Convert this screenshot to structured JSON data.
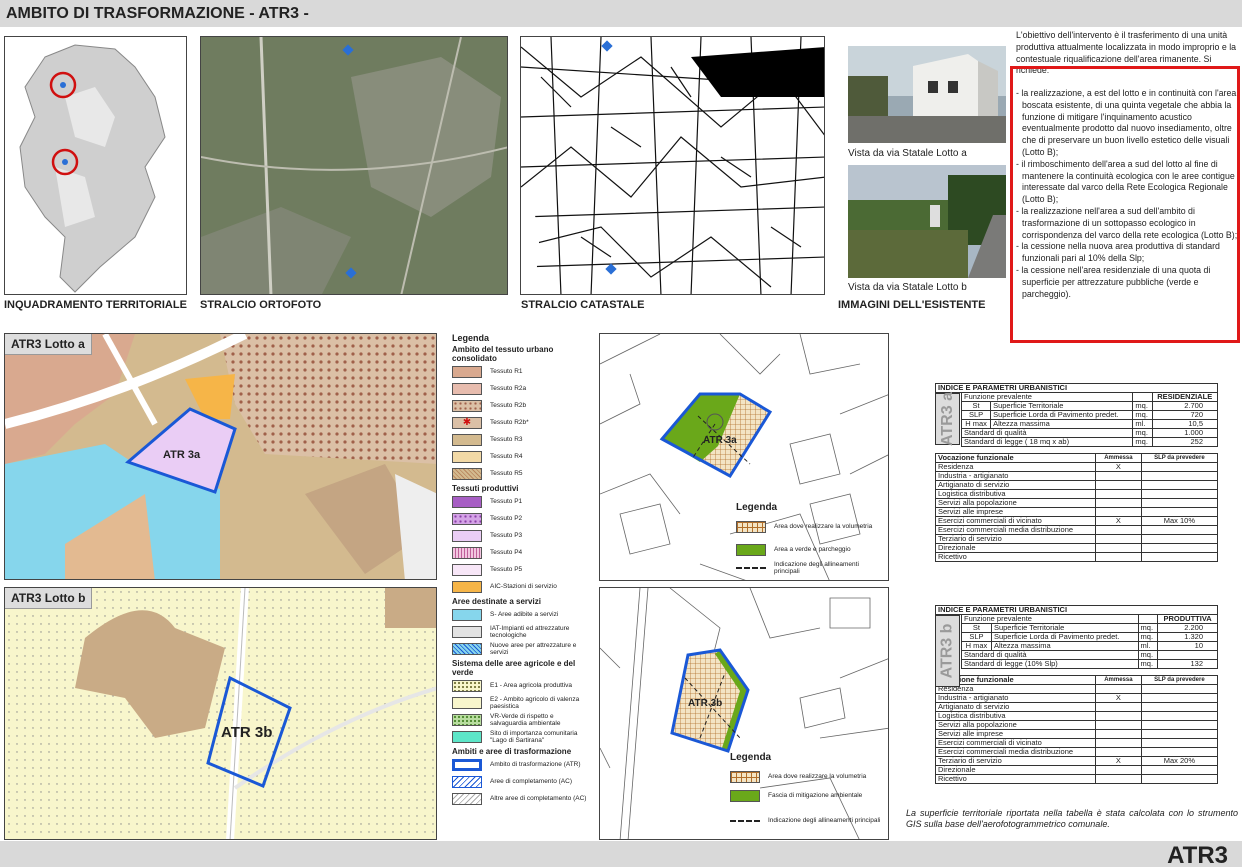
{
  "header": {
    "title": "AMBITO DI TRASFORMAZIONE - ATR3 -"
  },
  "footer": {
    "label": "ATR3"
  },
  "panels": {
    "inquadramento": "INQUADRAMENTO TERRITORIALE",
    "ortofoto": "STRALCIO ORTOFOTO",
    "catastale": "STRALCIO CATASTALE",
    "immagini": "IMMAGINI DELL'ESISTENTE"
  },
  "photos": {
    "a_caption": "Vista da via Statale Lotto a",
    "b_caption": "Vista da via Statale Lotto b"
  },
  "description": {
    "intro": "L'obiettivo dell'intervento è il trasferimento di una unità produttiva attualmente localizzata in modo improprio e la contestuale riqualificazione dell'area rimanente. Si richiede:",
    "items": [
      "- la realizzazione, a est del lotto e in continuità con l'area boscata esistente, di una quinta vegetale che abbia la funzione di mitigare l'inquinamento acustico eventualmente prodotto dal nuovo insediamento, oltre che di preservare un buon livello estetico delle visuali (Lotto B);",
      "- il rimboschimento dell'area a sud del lotto al fine di mantenere la continuità ecologica con le aree contigue interessate dal varco della Rete Ecologica Regionale (Lotto B);",
      "- la realizzazione nell'area a sud dell'ambito di trasformazione di un sottopasso ecologico in corrispondenza del varco della rete ecologica (Lotto B);",
      "- la cessione nella nuova area produttiva di standard funzionali pari al 10% della Slp;",
      "- la cessione nell'area residenziale di una quota di superficie per attrezzature pubbliche (verde e parcheggio)."
    ]
  },
  "lotto_a": {
    "title": "ATR3 Lotto a",
    "label": "ATR 3a"
  },
  "lotto_b": {
    "title": "ATR3 Lotto b",
    "label": "ATR 3b"
  },
  "legend": {
    "title": "Legenda",
    "groups": [
      {
        "title": "Ambito del tessuto urbano consolidato",
        "items": [
          "Tessuto R1",
          "Tessuto R2a",
          "Tessuto R2b",
          "Tessuto R2b*",
          "Tessuto R3",
          "Tessuto R4",
          "Tessuto R5"
        ]
      },
      {
        "title": "Tessuti produttivi",
        "items": [
          "Tessuto P1",
          "Tessuto P2",
          "Tessuto P3",
          "Tessuto P4",
          "Tessuto P5",
          "AIC-Stazioni di servizio"
        ]
      },
      {
        "title": "Aree destinate a servizi",
        "items": [
          "S- Aree adibite a servizi",
          "IAT-Impianti ed attrezzature tecnologiche",
          "Nuove aree per attrezzature e servizi"
        ]
      },
      {
        "title": "Sistema delle aree agricole e del verde",
        "items": [
          "E1 - Area agricola produttiva",
          "E2 - Ambito agricolo di valenza paesistica",
          "VR-Verde di rispetto e salvaguardia ambientale",
          "Sito di importanza comunitaria \"Lago di Sartirana\""
        ]
      },
      {
        "title": "Ambiti e aree di trasformazione",
        "items": [
          "Ambito di trasformazione (ATR)",
          "Aree di completamento (AC)",
          "Altre aree di completamento (AC)"
        ]
      }
    ]
  },
  "scheme_a": {
    "label": "ATR 3a",
    "legend_title": "Legenda",
    "items": [
      "Area dove realizzare la volumetria",
      "Area a verde e parcheggio",
      "Indicazione degli allineamenti principali"
    ]
  },
  "scheme_b": {
    "label": "ATR 3b",
    "legend_title": "Legenda",
    "items": [
      "Area dove realizzare la volumetria",
      "Fascia di mitigazione ambientale",
      "Indicazione degli allineamenti principali"
    ]
  },
  "table_a": {
    "side": "ATR3 a",
    "title": "INDICE E PARAMETRI URBANISTICI",
    "funzione": "Funzione prevalente",
    "funzione_val": "RESIDENZIALE",
    "rows": [
      [
        "St",
        "Superficie Territoriale",
        "mq.",
        "2.700"
      ],
      [
        "SLP",
        "Superficie Lorda di Pavimento predet.",
        "mq.",
        "720"
      ],
      [
        "H max",
        "Altezza massima",
        "ml.",
        "10,5"
      ],
      [
        "",
        "Standard di qualità",
        "mq.",
        "1.000"
      ],
      [
        "",
        "Standard di legge ( 18 mq x ab)",
        "mq.",
        "252"
      ]
    ],
    "voc_title": "Vocazione funzionale",
    "ammessa": "Ammessa",
    "slp_prev": "SLP da prevedere",
    "voc": [
      [
        "Residenza",
        "X",
        ""
      ],
      [
        "Industria - artigianato",
        "",
        ""
      ],
      [
        "Artigianato di servizio",
        "",
        ""
      ],
      [
        "Logistica distributiva",
        "",
        ""
      ],
      [
        "Servizi alla popolazione",
        "",
        ""
      ],
      [
        "Servizi alle imprese",
        "",
        ""
      ],
      [
        "Esercizi commerciali di vicinato",
        "X",
        "Max 10%"
      ],
      [
        "Esercizi commerciali media distribuzione",
        "",
        ""
      ],
      [
        "Terziario di servizio",
        "",
        ""
      ],
      [
        "Direzionale",
        "",
        ""
      ],
      [
        "Ricettivo",
        "",
        ""
      ]
    ]
  },
  "table_b": {
    "side": "ATR3 b",
    "title": "INDICE E PARAMETRI URBANISTICI",
    "funzione": "Funzione prevalente",
    "funzione_val": "PRODUTTIVA",
    "rows": [
      [
        "St",
        "Superficie Territoriale",
        "mq.",
        "2.200"
      ],
      [
        "SLP",
        "Superficie Lorda di Pavimento predet.",
        "mq.",
        "1.320"
      ],
      [
        "H max",
        "Altezza massima",
        "ml.",
        "10"
      ],
      [
        "",
        "Standard di qualità",
        "mq.",
        ""
      ],
      [
        "",
        "Standard di legge (10% Slp)",
        "mq.",
        "132"
      ]
    ],
    "voc_title": "Vocazione funzionale",
    "ammessa": "Ammessa",
    "slp_prev": "SLP da prevedere",
    "voc": [
      [
        "Residenza",
        "",
        ""
      ],
      [
        "Industria - artigianato",
        "X",
        ""
      ],
      [
        "Artigianato di servizio",
        "",
        ""
      ],
      [
        "Logistica distributiva",
        "",
        ""
      ],
      [
        "Servizi alla popolazione",
        "",
        ""
      ],
      [
        "Servizi alle imprese",
        "",
        ""
      ],
      [
        "Esercizi commerciali di vicinato",
        "",
        ""
      ],
      [
        "Esercizi commerciali media distribuzione",
        "",
        ""
      ],
      [
        "Terziario di servizio",
        "X",
        "Max 20%"
      ],
      [
        "Direzionale",
        "",
        ""
      ],
      [
        "Ricettivo",
        "",
        ""
      ]
    ]
  },
  "note": "La superficie territoriale riportata nella tabella è stata calcolata con lo strumento GIS sulla base dell'aerofotogrammetrico comunale."
}
